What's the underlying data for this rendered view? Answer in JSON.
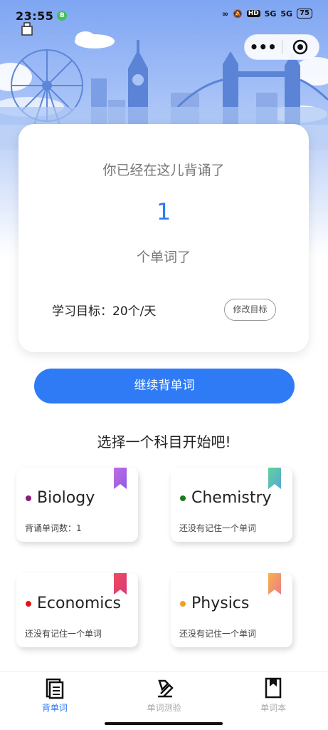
{
  "status_bar": {
    "time": "23:55",
    "badge": "B",
    "hd": "HD",
    "signal1": "5G",
    "signal2": "5G",
    "battery": "75"
  },
  "capsule": {
    "menu_icon": "more-dots-icon",
    "close_icon": "target-icon"
  },
  "stats": {
    "intro": "你已经在这儿背诵了",
    "count": "1",
    "unit": "个单词了",
    "goal": "学习目标：20个/天",
    "edit_goal_label": "修改目标"
  },
  "continue_label": "继续背单词",
  "section_title": "选择一个科目开始吧!",
  "subjects": [
    {
      "name": "Biology",
      "detail": "背诵单词数：1",
      "dot_color": "#8b1a7a",
      "ribbon": [
        "#c26de2",
        "#8e5ae6"
      ]
    },
    {
      "name": "Chemistry",
      "detail": "还没有记住一个单词",
      "dot_color": "#1b7a1b",
      "ribbon": [
        "#5ed49a",
        "#58a6d8"
      ]
    },
    {
      "name": "Economics",
      "detail": "还没有记住一个单词",
      "dot_color": "#e01616",
      "ribbon": [
        "#f04a5c",
        "#d73a7a"
      ]
    },
    {
      "name": "Physics",
      "detail": "还没有记住一个单词",
      "dot_color": "#f0a020",
      "ribbon": [
        "#f6b24a",
        "#ee7a8c"
      ]
    }
  ],
  "tabs": [
    {
      "label": "背单词",
      "icon": "notebook-icon",
      "active": true
    },
    {
      "label": "单词测验",
      "icon": "quiz-icon",
      "active": false
    },
    {
      "label": "单词本",
      "icon": "bookmark-book-icon",
      "active": false
    }
  ],
  "colors": {
    "accent": "#2f7bf5"
  }
}
